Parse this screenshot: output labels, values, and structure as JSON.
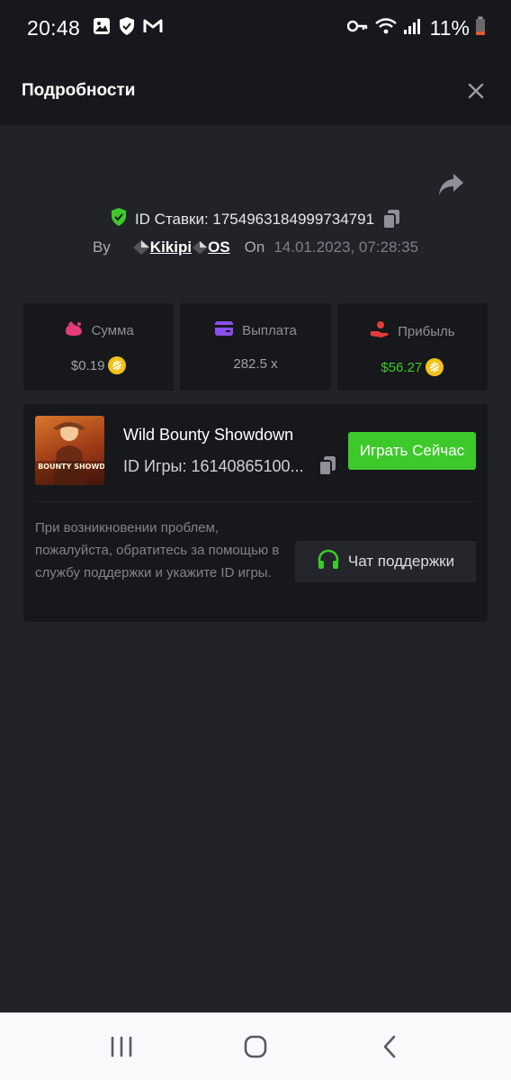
{
  "status_bar": {
    "time": "20:48",
    "battery": "11%"
  },
  "header": {
    "title": "Подробности"
  },
  "bet": {
    "id_label": "ID Ставки: 1754963184999734791",
    "by_label": "By",
    "username": "Kikipi",
    "username_suffix": "OS",
    "on_label": "On",
    "date": "14.01.2023, 07:28:35"
  },
  "stats": [
    {
      "label": "Сумма",
      "value": "$0.19"
    },
    {
      "label": "Выплата",
      "value": "282.5 x"
    },
    {
      "label": "Прибыль",
      "value": "$56.27"
    }
  ],
  "game": {
    "title": "Wild Bounty Showdown",
    "id_text": "ID Игры: 16140865100...",
    "thumb_text": "WILD BOUNTY SHOWDOWN",
    "play_label": "Играть Сейчас"
  },
  "help": {
    "text": "При возникновении проблем, пожалуйста, обратитесь за помощью в службу поддержки и укажите ID игры.",
    "support_label": "Чат поддержки"
  },
  "colors": {
    "accent_green": "#3ec92b",
    "coin": "#f2c21b",
    "background": "#222328",
    "panel": "#17181c"
  }
}
